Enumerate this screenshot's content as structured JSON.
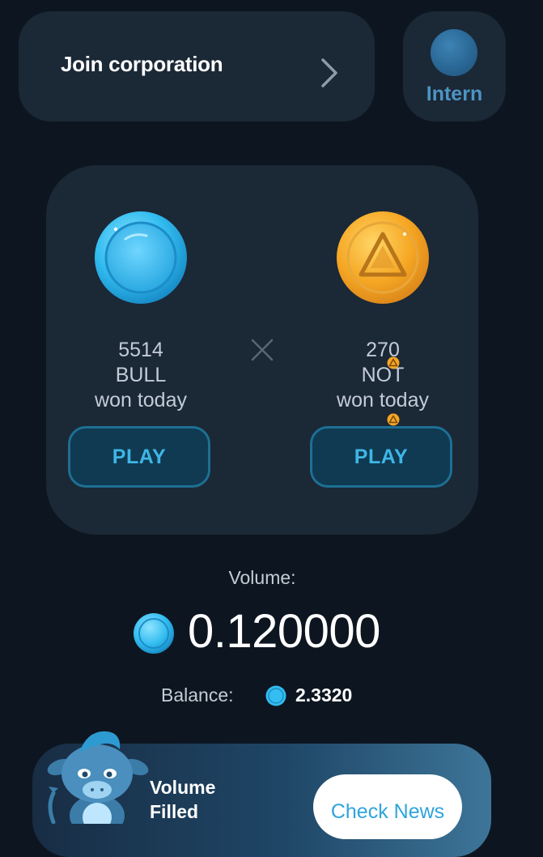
{
  "header": {
    "join_label": "Join corporation",
    "rank_label": "Intern"
  },
  "battle": {
    "bull": {
      "count": "5514",
      "ticker": "BULL",
      "caption": "won today",
      "play_label": "PLAY",
      "coin_color": "#3ec4f5"
    },
    "not": {
      "count": "270",
      "ticker": "NOT",
      "caption": "won today",
      "play_label": "PLAY",
      "coin_color": "#f5a623"
    }
  },
  "volume": {
    "label": "Volume:",
    "value": "0.120000"
  },
  "balance": {
    "label": "Balance:",
    "value": "2.3320"
  },
  "banner": {
    "line1": "Volume",
    "line2": "Filled",
    "button_label": "Check News"
  },
  "colors": {
    "background": "#0d1620",
    "card": "#1b2836",
    "accent": "#3fb6e6"
  }
}
